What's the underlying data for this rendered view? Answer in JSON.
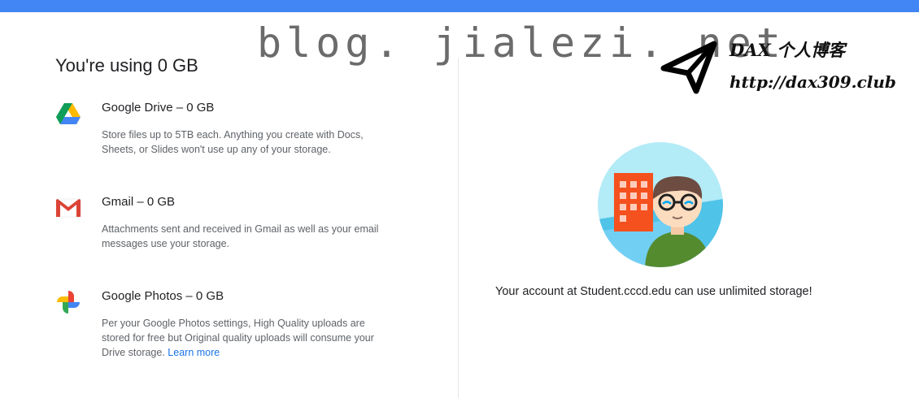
{
  "watermark": {
    "text": "blog. jialezi. net"
  },
  "brand": {
    "title": "DAX 个人博客",
    "url": "http://dax309.club"
  },
  "storage": {
    "heading": "You're using 0 GB",
    "items": [
      {
        "icon": "google-drive-icon",
        "title": "Google Drive – 0 GB",
        "description": "Store files up to 5TB each. Anything you create with Docs, Sheets, or Slides won't use up any of your storage."
      },
      {
        "icon": "gmail-icon",
        "title": "Gmail – 0 GB",
        "description": "Attachments sent and received in Gmail as well as your email messages use your storage."
      },
      {
        "icon": "google-photos-icon",
        "title": "Google Photos – 0 GB",
        "description": "Per your Google Photos settings, High Quality uploads are stored for free but Original quality uploads will consume your Drive storage.",
        "link_label": "Learn more"
      }
    ]
  },
  "account": {
    "message": "Your account at Student.cccd.edu can use unlimited storage!"
  },
  "colors": {
    "top_bar": "#4285f4",
    "link": "#1a73e8",
    "building": "#f4511e",
    "avatar_bg": "#b3ebf7",
    "shirt": "#558b2f"
  }
}
